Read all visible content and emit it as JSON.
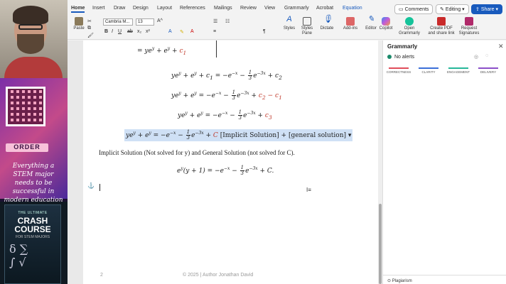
{
  "tabs": [
    "Home",
    "Insert",
    "Draw",
    "Design",
    "Layout",
    "References",
    "Mailings",
    "Review",
    "View",
    "Grammarly",
    "Acrobat",
    "Equation"
  ],
  "actions": {
    "comments": "Comments",
    "editing": "Editing",
    "share": "Share"
  },
  "ribbon": {
    "paste": "Paste",
    "font_name": "Cambria M...",
    "font_size": "13",
    "styles": "Styles",
    "styles_pane": "Styles Pane",
    "dictate": "Dictate",
    "addins": "Add-ins",
    "editor": "Editor",
    "copilot": "Copilot",
    "open_grammarly": "Open Grammarly",
    "create_pdf": "Create PDF and share link",
    "request_signatures": "Request Signatures"
  },
  "promo": {
    "order": "ORDER",
    "tagline": "Everything a STEM major needs to be successful in modern education",
    "book_top": "THE ULTIMATE",
    "book_title": "CRASH COURSE",
    "book_sub": "FOR STEM MAJORS"
  },
  "doc": {
    "line0": "= ye",
    "eq1": "ye",
    "eq2": "ye",
    "eq3": "ye",
    "eq4": "ye",
    "implicit_label": "[Implicit Solution] + [general solution]",
    "para": "Implicit Solution (Not solved for y) and General Solution (not solved for C).",
    "final": "e",
    "page_number": "2",
    "footer": "© 2025 | Author Jonathan David"
  },
  "grammarly": {
    "title": "Grammarly",
    "status": "No alerts",
    "categories": [
      {
        "name": "CORRECTNESS",
        "color": "#e04d5a"
      },
      {
        "name": "CLARITY",
        "color": "#3b6fd8"
      },
      {
        "name": "ENGAGEMENT",
        "color": "#26b79a"
      },
      {
        "name": "DELIVERY",
        "color": "#8b4fc9"
      }
    ],
    "plagiarism": "Plagiarism"
  }
}
